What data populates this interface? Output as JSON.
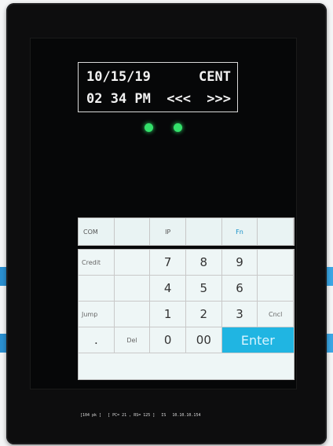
{
  "clock": {
    "date": "10/15/19",
    "zone": "CENT",
    "time": "02 34 PM",
    "prev": "<<<",
    "next": ">>>"
  },
  "topbar": [
    "COM",
    "",
    "IP",
    "",
    "Fn",
    ""
  ],
  "keys": {
    "row1": [
      "Credit",
      "",
      "7",
      "8",
      "9",
      ""
    ],
    "row2": [
      "",
      "",
      "4",
      "5",
      "6",
      ""
    ],
    "row3": [
      "Jump",
      "",
      "1",
      "2",
      "3",
      "Cncl"
    ],
    "row4": [
      ".",
      "Del",
      "0",
      "00",
      "Enter"
    ]
  },
  "status": {
    "left": "[104 pk ]",
    "mid": "[ PC= 21 , RS= 125 ]",
    "tag": "IS",
    "ip": "10.10.10.154"
  },
  "colors": {
    "enter": "#20b5e2",
    "led": "#33e06a"
  }
}
